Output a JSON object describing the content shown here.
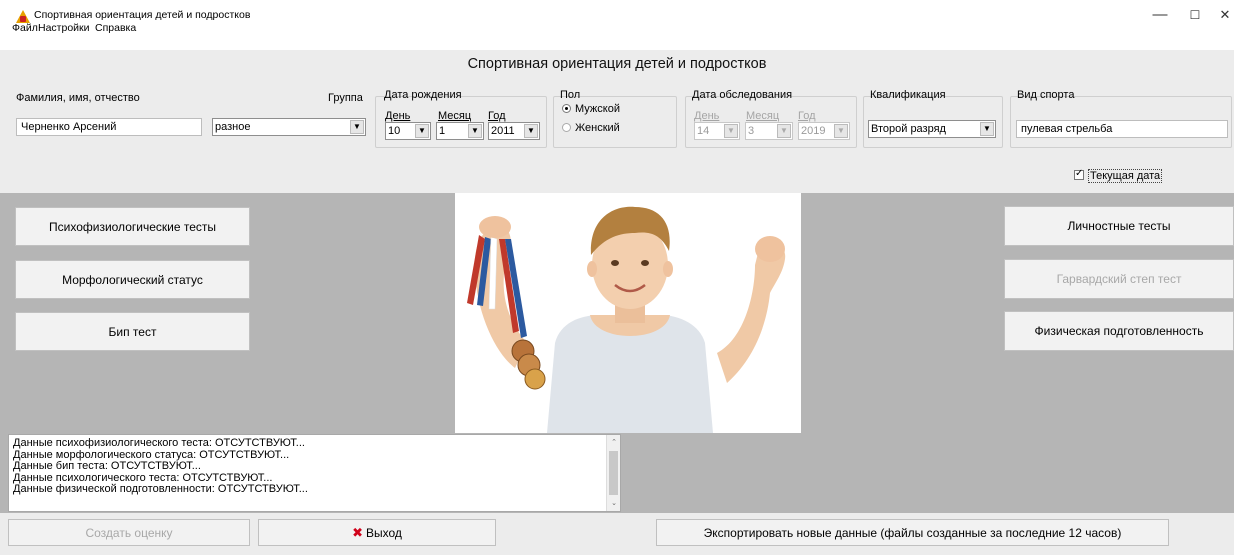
{
  "window": {
    "title": "Спортивная ориентация детей и  подростков",
    "minimize": "—",
    "maximize": "☐",
    "close": "✕"
  },
  "menu": [
    "Файл",
    "Настройки",
    "Справка"
  ],
  "header": {
    "title": "Спортивная ориентация детей и подростков"
  },
  "form": {
    "name_label": "Фамилия, имя, отчество",
    "name_value": "Черненко Арсений",
    "group_label": "Группа",
    "group_value": "разное",
    "birth": {
      "title": "Дата рождения",
      "day_label": "День",
      "month_label": "Месяц",
      "year_label": "Год",
      "day": "10",
      "month": "1",
      "year": "2011"
    },
    "sex": {
      "title": "Пол",
      "male": "Мужской",
      "female": "Женский",
      "selected": "male"
    },
    "exam": {
      "title": "Дата обследования",
      "day_label": "День",
      "month_label": "Месяц",
      "year_label": "Год",
      "day": "14",
      "month": "3",
      "year": "2019"
    },
    "qualification": {
      "title": "Квалификация",
      "value": "Второй разряд"
    },
    "sport": {
      "title": "Вид спорта",
      "value": "пулевая стрельба"
    },
    "current_date_label": "Текущая дата",
    "current_date_checked": true
  },
  "left_buttons": [
    "Психофизиологические тесты",
    "Морфологический статус",
    "Бип тест"
  ],
  "right_buttons": [
    {
      "label": "Личностные тесты",
      "enabled": true
    },
    {
      "label": "Гарвардский степ тест",
      "enabled": false
    },
    {
      "label": "Физическая подготовленность",
      "enabled": true
    }
  ],
  "log_lines": [
    "Данные психофизиологического теста: ОТСУТСТВУЮТ...",
    "Данные морфологического статуса: ОТСУТСТВУЮТ...",
    "Данные бип теста: ОТСУТСТВУЮТ...",
    "Данные психологического теста: ОТСУТСТВУЮТ...",
    "Данные физической подготовленности: ОТСУТСТВУЮТ..."
  ],
  "bottom": {
    "create_label": "Создать оценку",
    "exit_label": "Выход",
    "export_label": "Экспортировать новые данные (файлы  созданные за последние 12 часов)"
  },
  "colors": {
    "work_area": "#b5b5b5",
    "exit_icon": "#d0021b",
    "app_icon": "#e8a000"
  }
}
